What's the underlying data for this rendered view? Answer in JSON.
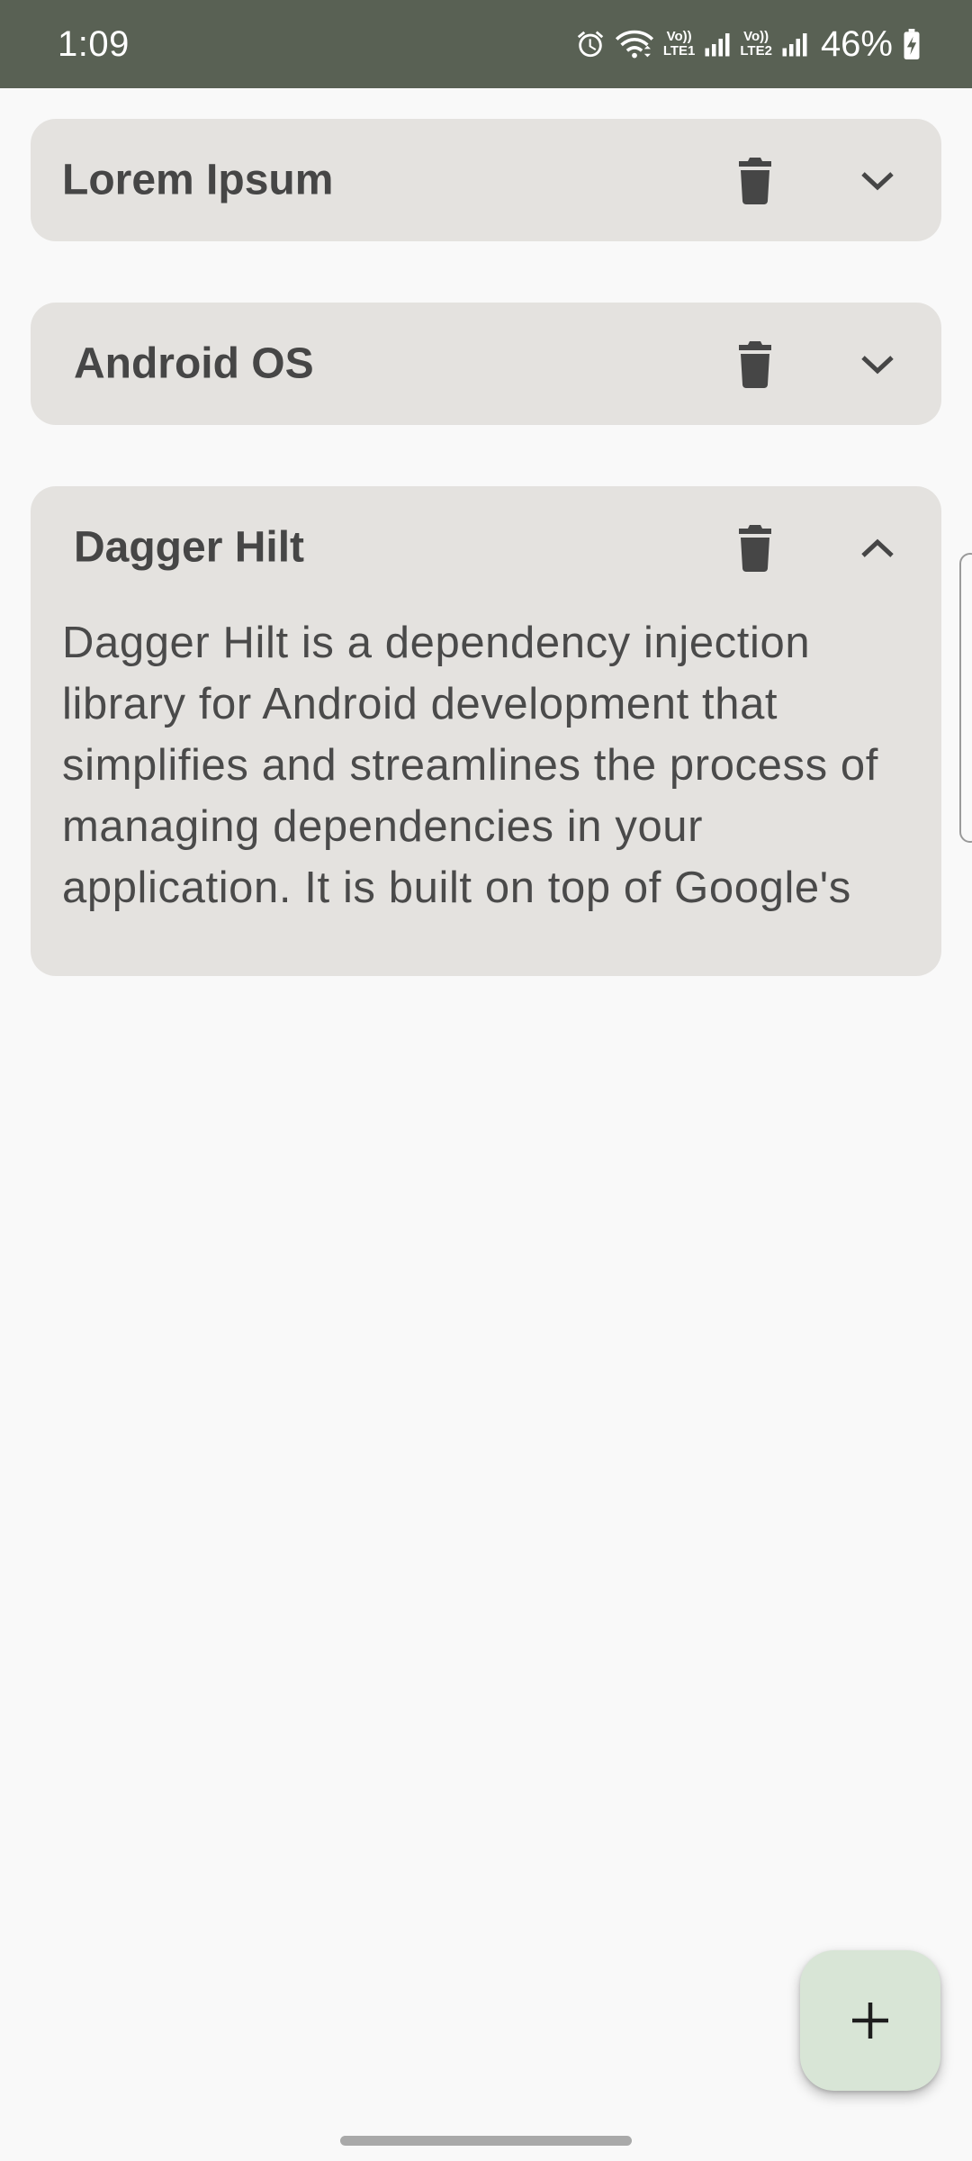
{
  "status_bar": {
    "time": "1:09",
    "battery": "46%",
    "sim1_label_top": "Vo))",
    "sim1_label_bottom": "LTE1",
    "sim2_label_top": "Vo))",
    "sim2_label_bottom": "LTE2",
    "icons": [
      "alarm-icon",
      "wifi-icon",
      "signal-icon",
      "signal-icon",
      "battery-charging-icon"
    ]
  },
  "notes": [
    {
      "title": "Lorem Ipsum",
      "expanded": false
    },
    {
      "title": "Android OS",
      "expanded": false
    },
    {
      "title": "Dagger Hilt",
      "expanded": true,
      "body": " Dagger Hilt is a dependency injection library for Android development that simplifies and streamlines the process of managing dependencies in your application. It is built on top of Google's"
    }
  ],
  "fab": {
    "icon": "plus-icon"
  },
  "colors": {
    "status_bar": "#596154",
    "background": "#f9f9f9",
    "card": "#e4e2df",
    "fab": "#d8e5d6",
    "icon": "#464646"
  }
}
